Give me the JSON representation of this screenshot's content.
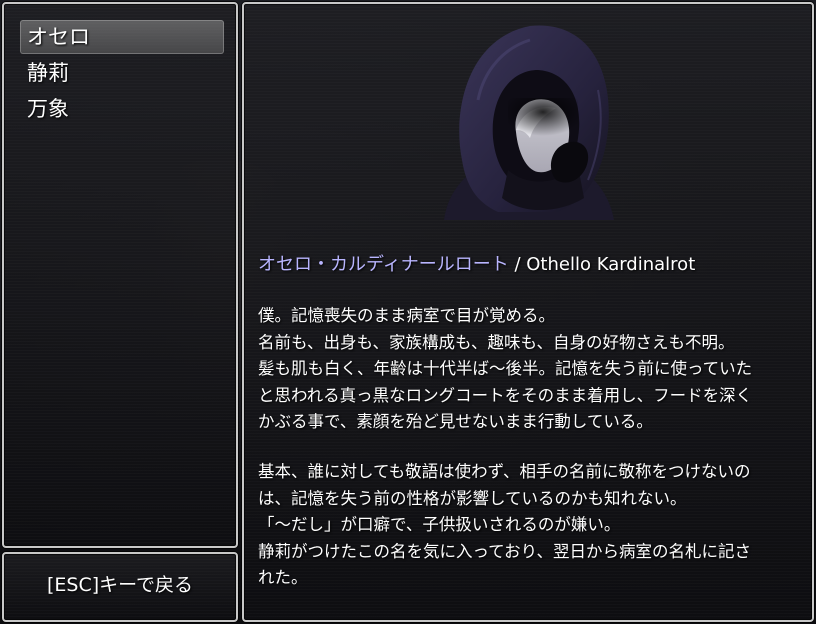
{
  "character_list": {
    "items": [
      {
        "label": "オセロ",
        "selected": true
      },
      {
        "label": "静莉",
        "selected": false
      },
      {
        "label": "万象",
        "selected": false
      }
    ]
  },
  "help": {
    "text": "[ESC]キーで戻る"
  },
  "detail": {
    "name_jp": "オセロ・カルディナールロート",
    "separator": " / ",
    "name_en": "Othello Kardinalrot",
    "paragraph1": [
      "僕。記憶喪失のまま病室で目が覚める。",
      "名前も、出身も、家族構成も、趣味も、自身の好物さえも不明。",
      "髪も肌も白く、年齢は十代半ば～後半。記憶を失う前に使っていた",
      "と思われる真っ黒なロングコートをそのまま着用し、フードを深く",
      "かぶる事で、素顔を殆ど見せないまま行動している。"
    ],
    "paragraph2": [
      "基本、誰に対しても敬語は使わず、相手の名前に敬称をつけないの",
      "は、記憶を失う前の性格が影響しているのかも知れない。",
      "「～だし」が口癖で、子供扱いされるのが嫌い。",
      "静莉がつけたこの名を気に入っており、翌日から病室の名札に記さ",
      "れた。"
    ]
  },
  "colors": {
    "name_accent": "#b9b5ff",
    "window_border": "#c8c8c8",
    "hood": "#2e2a48"
  }
}
